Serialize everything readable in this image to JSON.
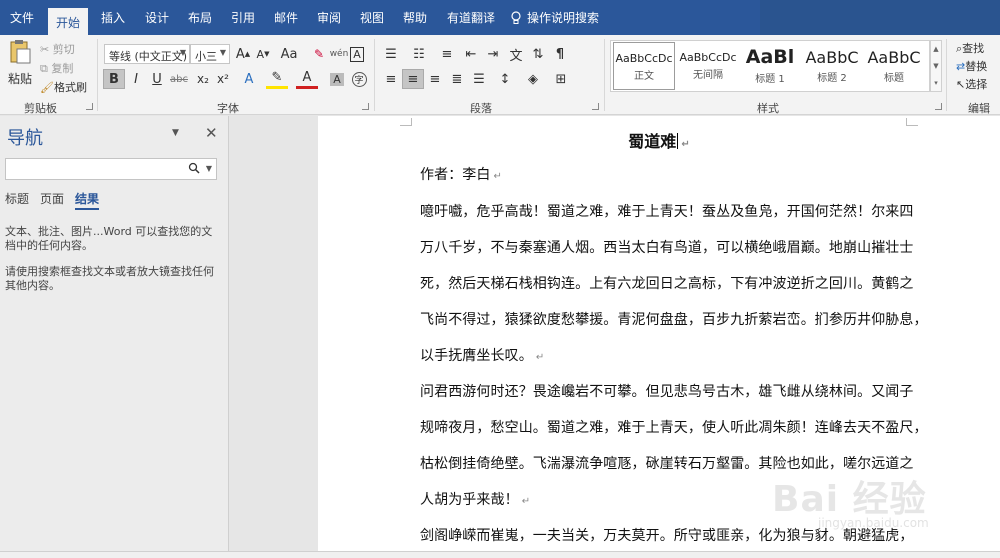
{
  "tabs": [
    "文件",
    "开始",
    "插入",
    "设计",
    "布局",
    "引用",
    "邮件",
    "审阅",
    "视图",
    "帮助",
    "有道翻译"
  ],
  "active_tab": "开始",
  "tell_me": "操作说明搜索",
  "clipboard": {
    "paste": "粘贴",
    "cut": "剪切",
    "copy": "复制",
    "format_painter": "格式刷",
    "label": "剪贴板"
  },
  "font": {
    "name": "等线 (中文正文)",
    "size": "小三",
    "label": "字体",
    "grow": "A",
    "shrink": "A",
    "case": "Aa",
    "bold": "B",
    "italic": "I",
    "underline": "U",
    "strike": "abc",
    "sub": "x₂",
    "sup": "x²",
    "font_color_a": "A",
    "highlight_a": "A"
  },
  "paragraph": {
    "label": "段落"
  },
  "styles": {
    "label": "样式",
    "items": [
      {
        "sample": "AaBbCcDc",
        "name": "正文"
      },
      {
        "sample": "AaBbCcDc",
        "name": "无间隔"
      },
      {
        "sample": "AaBl",
        "name": "标题 1"
      },
      {
        "sample": "AaBbC",
        "name": "标题 2"
      },
      {
        "sample": "AaBbC",
        "name": "标题"
      }
    ]
  },
  "editing": {
    "find": "查找",
    "replace": "替换",
    "select": "选择",
    "label": "编辑"
  },
  "nav": {
    "title": "导航",
    "tabs": [
      "标题",
      "页面",
      "结果"
    ],
    "active_tab": "结果",
    "text1": "文本、批注、图片...Word 可以查找您的文档中的任何内容。",
    "text2": "请使用搜索框查找文本或者放大镜查找任何其他内容。"
  },
  "document": {
    "title": "蜀道难",
    "author": "作者：李白",
    "lines": [
      "噫吁嚱，危乎高哉！蜀道之难，难于上青天！蚕丛及鱼凫，开国何茫然！尔来四",
      "万八千岁，不与秦塞通人烟。西当太白有鸟道，可以横绝峨眉巅。地崩山摧壮士",
      "死，然后天梯石栈相钩连。上有六龙回日之高标，下有冲波逆折之回川。黄鹤之",
      "飞尚不得过，猿猱欲度愁攀援。青泥何盘盘，百步九折萦岩峦。扪参历井仰胁息，",
      "以手抚膺坐长叹。",
      "问君西游何时还？畏途巉岩不可攀。但见悲鸟号古木，雄飞雌从绕林间。又闻子",
      "规啼夜月，愁空山。蜀道之难，难于上青天，使人听此凋朱颜！连峰去天不盈尺，",
      "枯松倒挂倚绝壁。飞湍瀑流争喧豗，砯崖转石万壑雷。其险也如此，嗟尔远道之",
      "人胡为乎来哉！",
      "剑阁峥嵘而崔嵬，一夫当关，万夫莫开。所守或匪亲，化为狼与豺。朝避猛虎，"
    ]
  },
  "watermark": {
    "text": "Bai 经验",
    "sub": "jingyan.baidu.com"
  }
}
